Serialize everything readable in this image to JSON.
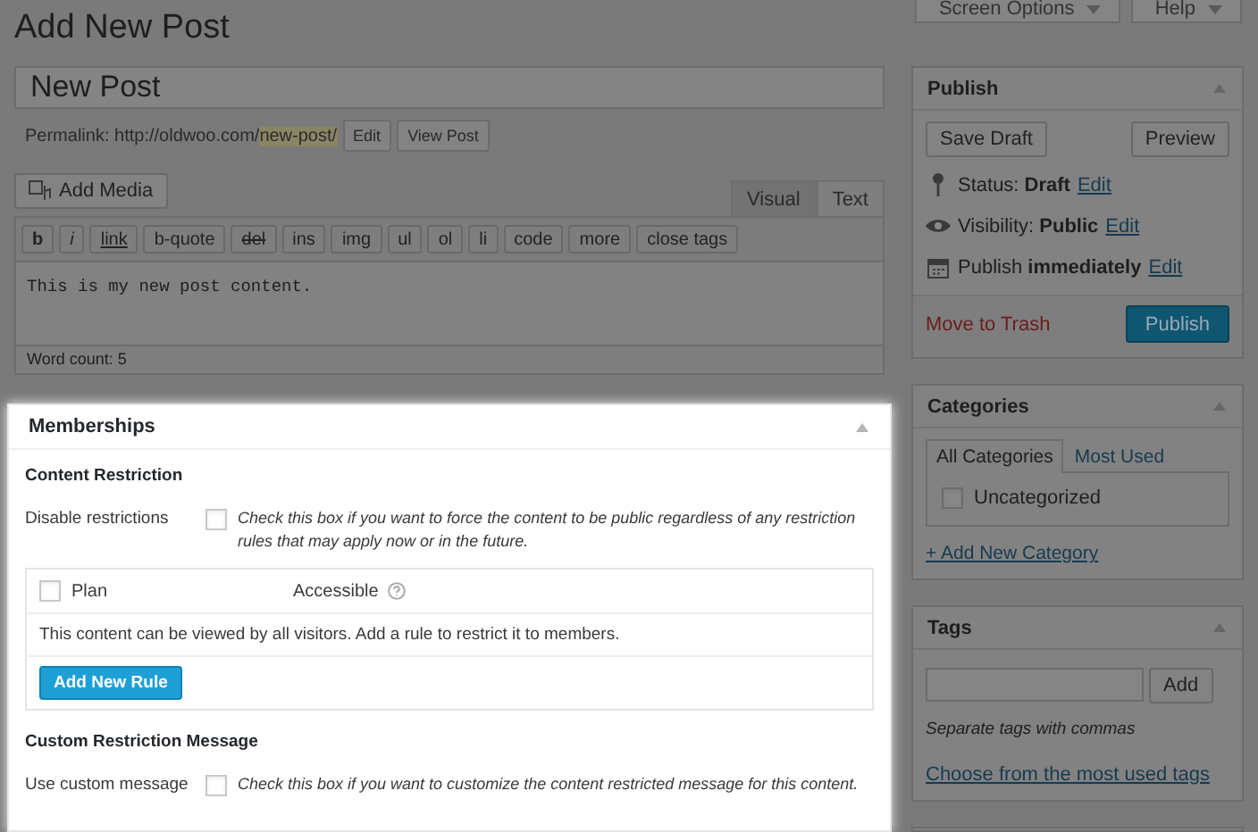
{
  "page_title": "Add New Post",
  "header_buttons": [
    "Screen Options",
    "Help"
  ],
  "post_title": {
    "value": "New Post"
  },
  "permalink": {
    "label": "Permalink:",
    "url_base": "http://oldwoo.com/",
    "slug": "new-post/",
    "buttons": [
      "Edit",
      "View Post"
    ]
  },
  "editor": {
    "add_media": "Add Media",
    "tabs": [
      {
        "label": "Visual",
        "selected": false
      },
      {
        "label": "Text",
        "selected": true
      }
    ],
    "quicktags": [
      {
        "label": "b",
        "kind": "bold"
      },
      {
        "label": "i",
        "kind": "italic"
      },
      {
        "label": "link",
        "kind": "link"
      },
      {
        "label": "b-quote",
        "kind": "plain"
      },
      {
        "label": "del",
        "kind": "strike"
      },
      {
        "label": "ins",
        "kind": "plain"
      },
      {
        "label": "img",
        "kind": "plain"
      },
      {
        "label": "ul",
        "kind": "plain"
      },
      {
        "label": "ol",
        "kind": "plain"
      },
      {
        "label": "li",
        "kind": "plain"
      },
      {
        "label": "code",
        "kind": "plain"
      },
      {
        "label": "more",
        "kind": "plain"
      },
      {
        "label": "close tags",
        "kind": "plain"
      }
    ],
    "content": "This is my new post content.",
    "word_count": "Word count: 5"
  },
  "memberships": {
    "title": "Memberships",
    "section": "Content Restriction",
    "disable": {
      "label": "Disable restrictions",
      "checked": false,
      "description": "Check this box if you want to force the content to be public regardless of any restriction rules that may apply now or in the future."
    },
    "table": {
      "checked": false,
      "columns": [
        "Plan",
        "Accessible"
      ],
      "message": "This content can be viewed by all visitors. Add a rule to restrict it to members.",
      "button": "Add New Rule"
    },
    "section_2": "Custom Restriction Message",
    "custom": {
      "label": "Use custom message",
      "checked": false,
      "description": "Check this box if you want to customize the content restricted message for this content."
    }
  },
  "publish": {
    "title": "Publish",
    "save_draft": "Save Draft",
    "preview": "Preview",
    "rows": [
      {
        "kind": "status",
        "text": "Status: **Draft**",
        "link": "Edit"
      },
      {
        "kind": "visibility",
        "text": "Visibility: **Public**",
        "link": "Edit"
      },
      {
        "kind": "schedule",
        "text": "Publish **immediately**",
        "link": "Edit"
      }
    ],
    "trash": "Move to Trash",
    "button": "Publish"
  },
  "categories": {
    "title": "Categories",
    "tabs": [
      {
        "label": "All Categories",
        "selected": true
      },
      {
        "label": "Most Used",
        "selected": false
      }
    ],
    "items": [
      {
        "label": "Uncategorized",
        "checked": false
      }
    ],
    "add_link": "+ Add New Category"
  },
  "tags": {
    "title": "Tags",
    "button": "Add",
    "hint": "Separate tags with commas",
    "link": "Choose from the most used tags"
  }
}
